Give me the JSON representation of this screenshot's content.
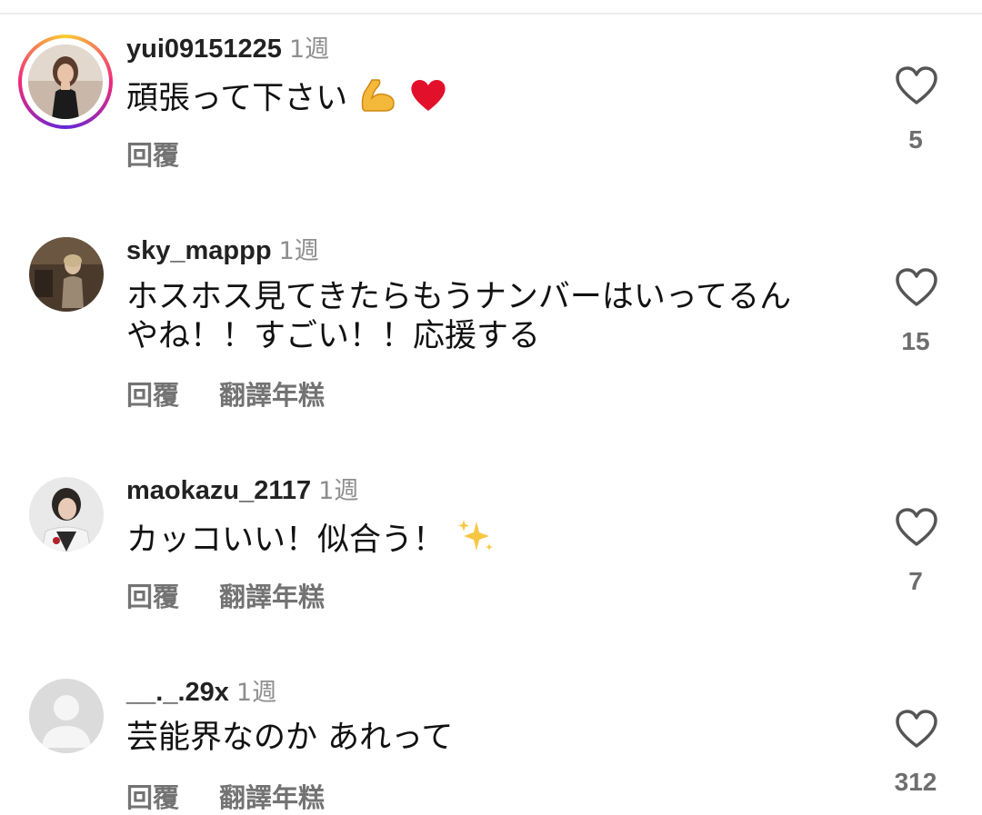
{
  "comments": [
    {
      "username": "yui09151225",
      "time": "1週",
      "text": "頑張って下さい",
      "emojis": [
        "flexed-biceps",
        "red-heart"
      ],
      "reply_label": "回覆",
      "likes": "5",
      "has_story_ring": true
    },
    {
      "username": "sky_mappp",
      "time": "1週",
      "text_line1": "ホスホス見てきたらもうナンバーはいってるん",
      "text_line2": "やね！！すごい！！応援する",
      "reply_label": "回覆",
      "translate_label": "翻譯年糕",
      "likes": "15"
    },
    {
      "username": "maokazu_2117",
      "time": "1週",
      "text": "カッコいい！似合う！",
      "emojis": [
        "sparkles"
      ],
      "reply_label": "回覆",
      "translate_label": "翻譯年糕",
      "likes": "7"
    },
    {
      "username": "__._.29x",
      "time": "1週",
      "text": "芸能界なのか あれって",
      "reply_label": "回覆",
      "translate_label": "翻譯年糕",
      "likes": "312",
      "avatar": "default-avatar"
    }
  ],
  "colors": {
    "accent_ring": "#ee2a7b",
    "secondary_text": "#737373",
    "timestamp": "#8e8e8e"
  }
}
